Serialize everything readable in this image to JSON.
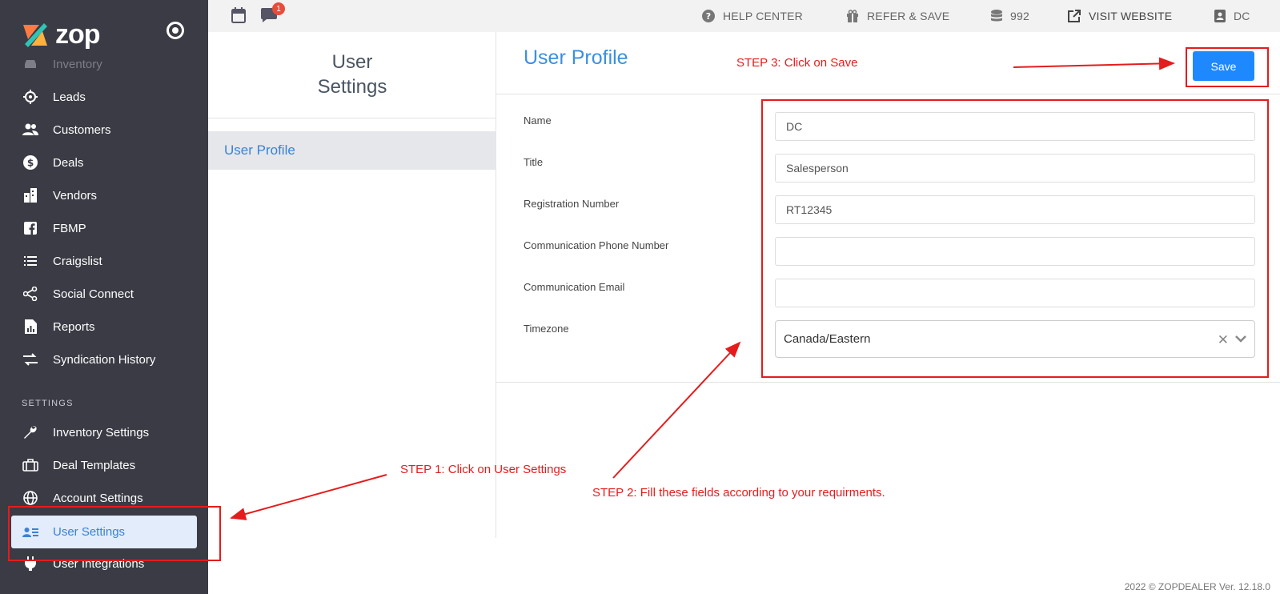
{
  "app": {
    "logo_text": "zop"
  },
  "sidebar": {
    "items": [
      {
        "label": "Inventory",
        "icon": "car-icon"
      },
      {
        "label": "Leads",
        "icon": "target-icon"
      },
      {
        "label": "Customers",
        "icon": "users-icon"
      },
      {
        "label": "Deals",
        "icon": "dollar-icon"
      },
      {
        "label": "Vendors",
        "icon": "building-icon"
      },
      {
        "label": "FBMP",
        "icon": "facebook-icon"
      },
      {
        "label": "Craigslist",
        "icon": "list-icon"
      },
      {
        "label": "Social Connect",
        "icon": "share-icon"
      },
      {
        "label": "Reports",
        "icon": "report-icon"
      },
      {
        "label": "Syndication History",
        "icon": "exchange-icon"
      }
    ],
    "settings_label": "SETTINGS",
    "settings_items": [
      {
        "label": "Inventory Settings",
        "icon": "wrench-icon"
      },
      {
        "label": "Deal Templates",
        "icon": "suitcase-icon"
      },
      {
        "label": "Account Settings",
        "icon": "globe-icon"
      },
      {
        "label": "User Settings",
        "icon": "user-card-icon"
      },
      {
        "label": "User Integrations",
        "icon": "plug-icon"
      }
    ]
  },
  "topbar": {
    "notification_count": "1",
    "help_center": "HELP CENTER",
    "refer_save": "REFER & SAVE",
    "credits": "992",
    "visit_website": "VISIT WEBSITE",
    "user": "DC"
  },
  "settings_panel": {
    "title": "User Settings",
    "items": [
      {
        "label": "User Profile"
      }
    ]
  },
  "main": {
    "title": "User Profile",
    "save_label": "Save",
    "fields": [
      {
        "label": "Name",
        "value": "DC"
      },
      {
        "label": "Title",
        "value": "Salesperson"
      },
      {
        "label": "Registration Number",
        "value": "RT12345"
      },
      {
        "label": "Communication Phone Number",
        "value": ""
      },
      {
        "label": "Communication Email",
        "value": ""
      },
      {
        "label": "Timezone",
        "value": "Canada/Eastern"
      }
    ]
  },
  "annotations": {
    "step1": "STEP 1: Click on User Settings",
    "step2": "STEP 2: Fill these fields according to your requirments.",
    "step3": "STEP 3: Click on Save",
    "color": "#e51c1c"
  },
  "footer": "2022 © ZOPDEALER Ver. 12.18.0"
}
